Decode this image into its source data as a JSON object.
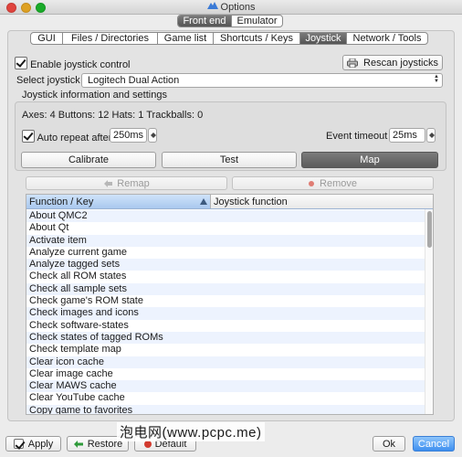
{
  "window": {
    "title": "Options"
  },
  "segment": {
    "items": [
      "Front end",
      "Emulator"
    ],
    "selected": 0
  },
  "tabs": {
    "items": [
      "GUI",
      "Files / Directories",
      "Game list",
      "Shortcuts / Keys",
      "Joystick",
      "Network / Tools"
    ],
    "selected": 4
  },
  "joystick": {
    "enable_label": "Enable joystick control",
    "enable_checked": true,
    "rescan_label": "Rescan joysticks",
    "select_label": "Select joystick",
    "select_value": "Logitech Dual Action",
    "info_group_label": "Joystick information and settings",
    "axes_label": "Axes:",
    "axes_value": "4",
    "buttons_label": "Buttons:",
    "buttons_value": "12",
    "hats_label": "Hats:",
    "hats_value": "1",
    "trackballs_label": "Trackballs:",
    "trackballs_value": "0",
    "auto_repeat_label": "Auto repeat after",
    "auto_repeat_checked": true,
    "auto_repeat_value": "250ms",
    "event_timeout_label": "Event timeout",
    "event_timeout_value": "25ms",
    "calibrate_label": "Calibrate",
    "test_label": "Test",
    "map_label": "Map",
    "remap_label": "Remap",
    "remove_label": "Remove"
  },
  "table": {
    "col1": "Function / Key",
    "col2": "Joystick function",
    "rows": [
      "About QMC2",
      "About Qt",
      "Activate item",
      "Analyze current game",
      "Analyze tagged sets",
      "Check all ROM states",
      "Check all sample sets",
      "Check game's ROM state",
      "Check images and icons",
      "Check software-states",
      "Check states of tagged ROMs",
      "Check template map",
      "Clear icon cache",
      "Clear image cache",
      "Clear MAWS cache",
      "Clear YouTube cache",
      "Copy game to favorites"
    ]
  },
  "footer": {
    "apply_label": "Apply",
    "restore_label": "Restore",
    "default_label": "Default",
    "ok_label": "Ok",
    "cancel_label": "Cancel"
  },
  "watermark": "泡电网(www.pcpc.me)",
  "colors": {
    "accent": "#3e8ff0",
    "selected_tab": "#666666",
    "restore_icon": "#2e9a3a",
    "remove_icon": "#d23b2f"
  }
}
